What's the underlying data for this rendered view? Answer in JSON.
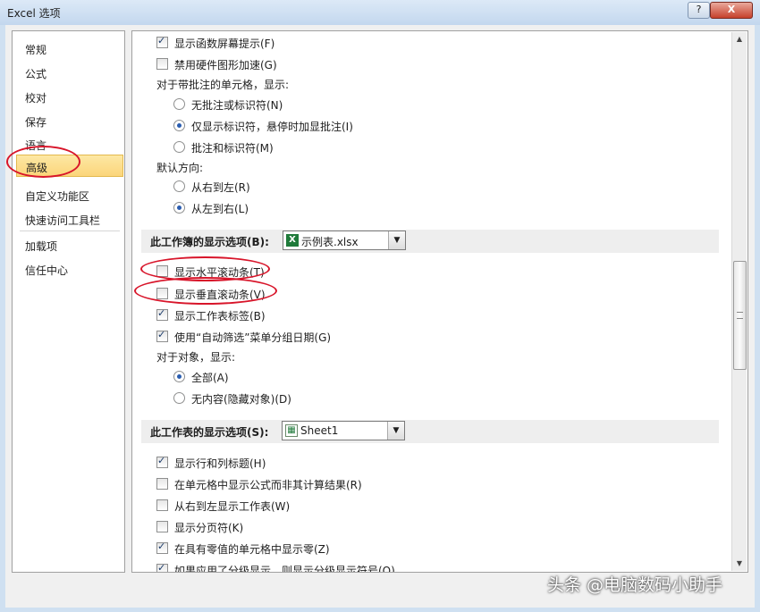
{
  "window": {
    "title": "Excel 选项",
    "help": "?",
    "close": "X"
  },
  "sidebar": {
    "items": [
      {
        "label": "常规"
      },
      {
        "label": "公式"
      },
      {
        "label": "校对"
      },
      {
        "label": "保存"
      },
      {
        "label": "语言"
      },
      {
        "label": "高级"
      },
      {
        "label": "自定义功能区"
      },
      {
        "label": "快速访问工具栏"
      },
      {
        "label": "加载项"
      },
      {
        "label": "信任中心"
      }
    ],
    "selected": "高级"
  },
  "content": {
    "opt_func_tooltip": "显示函数屏幕提示(F)",
    "opt_disable_hw": "禁用硬件图形加速(G)",
    "comments_heading": "对于带批注的单元格，显示:",
    "r_no_comments": "无批注或标识符(N)",
    "r_indicator_only": "仅显示标识符，悬停时加显批注(I)",
    "r_comments_indicators": "批注和标识符(M)",
    "direction_heading": "默认方向:",
    "r_rtl": "从右到左(R)",
    "r_ltr": "从左到右(L)",
    "workbook_section": "此工作簿的显示选项(B):",
    "workbook_value": "示例表.xlsx",
    "opt_hscroll": "显示水平滚动条(T)",
    "opt_vscroll": "显示垂直滚动条(V)",
    "opt_sheet_tabs": "显示工作表标签(B)",
    "opt_autofilter_dates": "使用“自动筛选”菜单分组日期(G)",
    "objects_heading": "对于对象，显示:",
    "r_all": "全部(A)",
    "r_nothing": "无内容(隐藏对象)(D)",
    "sheet_section": "此工作表的显示选项(S):",
    "sheet_value": "Sheet1",
    "opt_row_col_headers": "显示行和列标题(H)",
    "opt_formulas": "在单元格中显示公式而非其计算结果(R)",
    "opt_sheet_rtl": "从右到左显示工作表(W)",
    "opt_page_breaks": "显示分页符(K)",
    "opt_zero": "在具有零值的单元格中显示零(Z)",
    "opt_outline": "如果应用了分级显示，则显示分级显示符号(O)"
  },
  "states": {
    "opt_func_tooltip": true,
    "opt_disable_hw": false,
    "comments_choice": "indicator_only",
    "direction_choice": "ltr",
    "opt_hscroll": false,
    "opt_vscroll": false,
    "opt_sheet_tabs": true,
    "opt_autofilter_dates": true,
    "objects_choice": "all",
    "opt_row_col_headers": true,
    "opt_formulas": false,
    "opt_sheet_rtl": false,
    "opt_page_breaks": false,
    "opt_zero": true,
    "opt_outline": true
  },
  "annotation_color": "#d8152a",
  "watermark": "头条 @电脑数码小助手"
}
